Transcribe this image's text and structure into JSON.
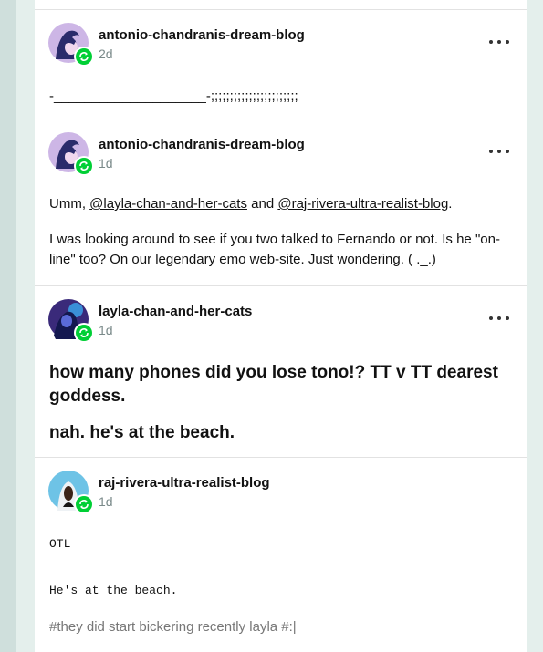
{
  "posts": [
    {
      "username": "antonio-chandranis-dream-blog",
      "time": "2d",
      "body": "-____________________-;;;;;;;;;;;;;;;;;;;;;;;"
    },
    {
      "username": "antonio-chandranis-dream-blog",
      "time": "1d",
      "p1_prefix": "Umm, ",
      "mention1": "@layla-chan-and-her-cats",
      "p1_mid": " and ",
      "mention2": "@raj-rivera-ultra-realist-blog",
      "p1_suffix": ".",
      "p2": "I was looking around to see if you two talked to Fernando or not. Is he \"on-line\" too? On our legendary emo web-site. Just wondering.  (  ._.)"
    },
    {
      "username": "layla-chan-and-her-cats",
      "time": "1d",
      "line1": "how many phones did you lose tono!?  TT v TT  dearest goddess.",
      "line2": "nah. he's at the beach."
    },
    {
      "username": "raj-rivera-ultra-realist-blog",
      "time": "1d",
      "line1": "OTL",
      "line2": "He's at the beach.",
      "tags": "#they did start bickering recently layla   #:|"
    }
  ],
  "colors": {
    "reblog_badge": "#00cf35",
    "background": "#cfdfdc",
    "card": "#ffffff"
  },
  "icons": {
    "reblog": "reblog-icon",
    "more": "more-options-icon"
  }
}
